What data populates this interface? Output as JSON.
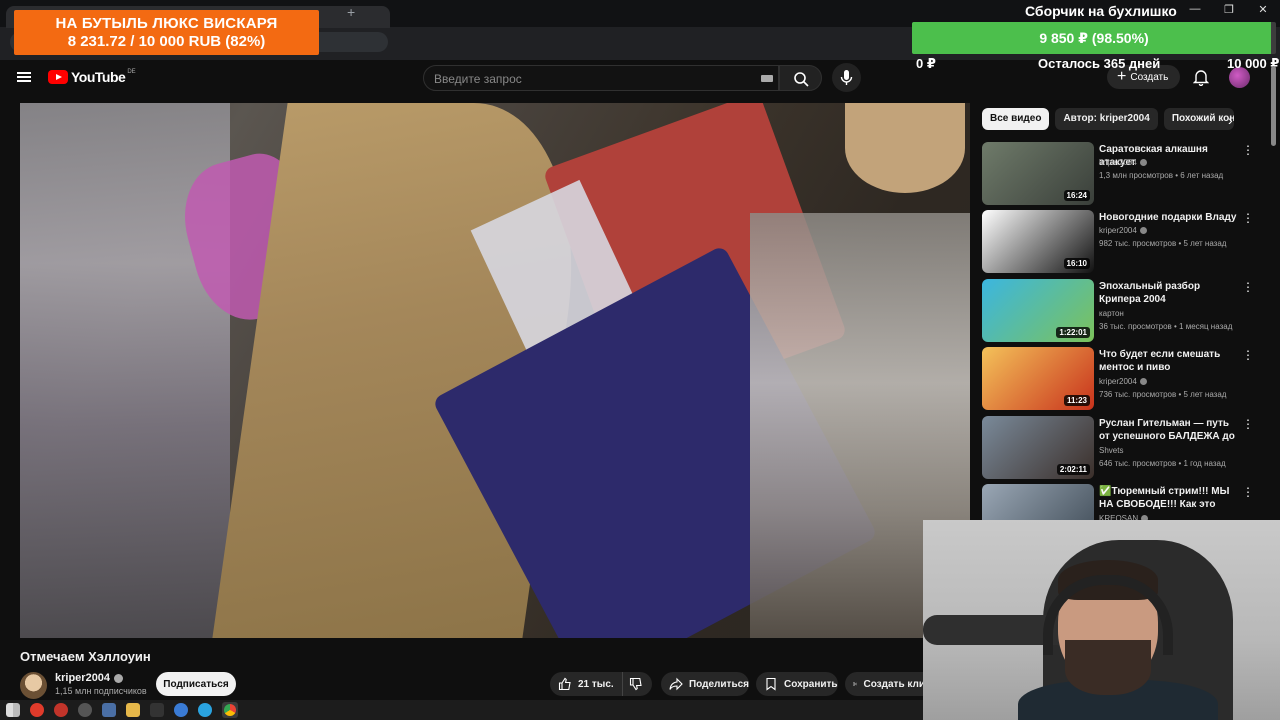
{
  "donation": {
    "line1": "НА БУТЫЛЬ ЛЮКС ВИСКАРЯ",
    "line2": "8 231.72 / 10 000 RUB (82%)",
    "progress": 0.82
  },
  "collection": {
    "title": "Сборчик на бухлишко",
    "bar_text": "9 850 ₽ (98.50%)",
    "progress": 0.985,
    "min_label": "0 ₽",
    "days_left": "Осталось 365 дней",
    "max_label": "10 000 ₽"
  },
  "header": {
    "logo_text": "YouTube",
    "region": "DE",
    "search_placeholder": "Введите запрос",
    "create_label": "Создать"
  },
  "video": {
    "title": "Отмечаем Хэллоуин",
    "channel": "kriper2004",
    "subscribers": "1,15 млн подписчиков",
    "subscribe_label": "Подписаться",
    "likes": "21 тыс.",
    "share_label": "Поделиться",
    "save_label": "Сохранить",
    "clip_label": "Создать кли"
  },
  "sidebar": {
    "chips": [
      "Все видео",
      "Автор: kriper2004",
      "Похожий кон"
    ],
    "recommendations": [
      {
        "title": "Саратовская алкашня атакует",
        "channel": "kriper2004",
        "verified": true,
        "meta": "1,3 млн просмотров • 6 лет назад",
        "duration": "16:24",
        "thumb_colors": [
          "#6f7b6a",
          "#3a3f3a"
        ]
      },
      {
        "title": "Новогодние подарки Владу",
        "channel": "kriper2004",
        "verified": true,
        "meta": "982 тыс. просмотров • 5 лет назад",
        "duration": "16:10",
        "thumb_colors": [
          "#ffffff",
          "#111111"
        ]
      },
      {
        "title": "Эпохальный разбор Крипера 2004",
        "channel": "картон",
        "verified": false,
        "meta": "36 тыс. просмотров • 1 месяц назад",
        "duration": "1:22:01",
        "thumb_colors": [
          "#3bb6e0",
          "#7cc25a"
        ]
      },
      {
        "title": "Что будет если смешать ментос и пиво",
        "channel": "kriper2004",
        "verified": true,
        "meta": "736 тыс. просмотров • 5 лет назад",
        "duration": "11:23",
        "thumb_colors": [
          "#f4c25a",
          "#c8321c"
        ]
      },
      {
        "title": "Руслан Гительман — путь от успешного БАЛДЕЖА до ...",
        "channel": "Shvets",
        "verified": false,
        "meta": "646 тыс. просмотров • 1 год назад",
        "duration": "2:02:11",
        "thumb_colors": [
          "#7a8a9a",
          "#3b2f2a"
        ]
      },
      {
        "title": "✅Тюремный стрим!!! МЫ НА СВОБОДЕ!!! Как это было НА...",
        "channel": "KREOSAN",
        "verified": true,
        "meta": "",
        "duration": "",
        "thumb_colors": [
          "#9aa7b5",
          "#3e4a55"
        ]
      }
    ]
  },
  "colors": {
    "donation_bg": "#f36a12",
    "collection_fill": "#4cbf4c",
    "youtube_red": "#ff0000"
  },
  "icons": [
    "menu-icon",
    "youtube-logo-icon",
    "keyboard-icon",
    "search-icon",
    "mic-icon",
    "plus-icon",
    "bell-icon",
    "like-icon",
    "dislike-icon",
    "share-icon",
    "save-icon",
    "scissors-icon",
    "kebab-icon",
    "chevron-right-icon",
    "verified-icon"
  ]
}
